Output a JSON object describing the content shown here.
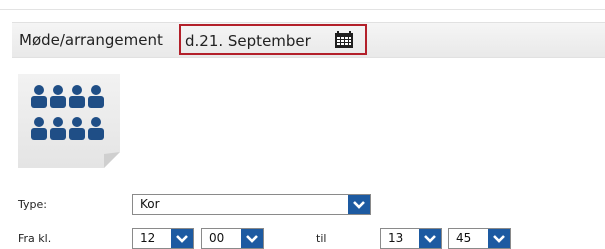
{
  "header": {
    "label": "Møde/arrangement",
    "date": "d.21. September",
    "calendar_icon": "calendar-icon"
  },
  "tile_icon": "people-group-icon",
  "form": {
    "type_label": "Type:",
    "type_value": "Kor",
    "from_label": "Fra kl.",
    "from_hour": "12",
    "from_minute": "00",
    "to_label": "til",
    "to_hour": "13",
    "to_minute": "45"
  },
  "colors": {
    "accent_blue": "#1d5aa1",
    "highlight_red": "#b3202a",
    "icon_blue": "#1f4e86"
  }
}
